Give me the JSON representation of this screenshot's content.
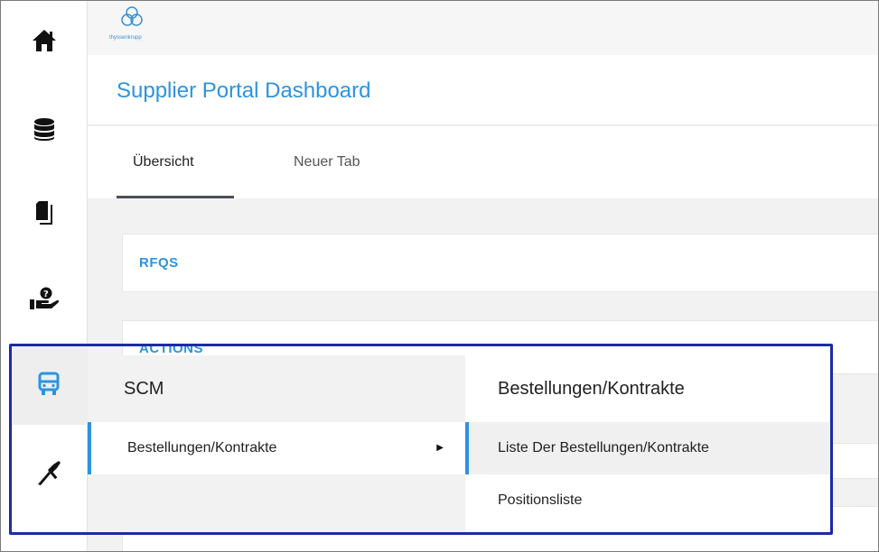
{
  "app": {
    "logo_text": "thyssenkrupp",
    "title": "Supplier Portal Dashboard"
  },
  "sidebar": {
    "items": [
      {
        "icon": "home-icon"
      },
      {
        "icon": "database-icon"
      },
      {
        "icon": "documents-icon"
      },
      {
        "icon": "help-hand-icon"
      },
      {
        "icon": "truck-icon"
      },
      {
        "icon": "tools-icon"
      }
    ]
  },
  "tabs": [
    {
      "label": "Übersicht",
      "active": true
    },
    {
      "label": "Neuer Tab",
      "active": false
    }
  ],
  "cards": [
    {
      "label": "RFQS"
    },
    {
      "label": "ACTIONS"
    }
  ],
  "menu": {
    "section_title": "SCM",
    "items": [
      {
        "label": "Bestellungen/Kontrakte",
        "has_submenu": true
      }
    ],
    "submenu": {
      "title": "Bestellungen/Kontrakte",
      "items": [
        {
          "label": "Liste Der Bestellungen/Kontrakte",
          "active": true
        },
        {
          "label": "Positionsliste",
          "active": false
        }
      ]
    }
  },
  "colors": {
    "accent": "#2d93e0",
    "highlight_border": "#1a2ba8"
  }
}
